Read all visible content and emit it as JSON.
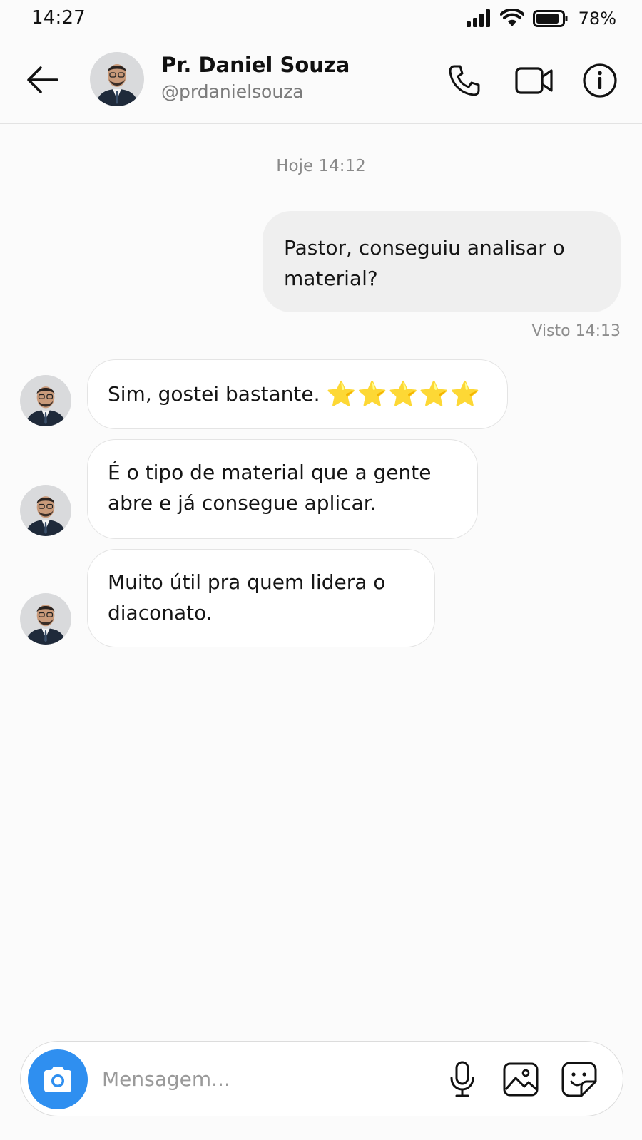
{
  "status_bar": {
    "time": "14:27",
    "battery": "78%"
  },
  "header": {
    "name": "Pr. Daniel Souza",
    "handle": "@prdanielsouza",
    "icons": [
      "back-arrow-icon",
      "phone-icon",
      "video-camera-icon",
      "info-icon"
    ]
  },
  "chat": {
    "timestamp": "Hoje 14:12",
    "outgoing": {
      "line1": "Pastor, conseguiu analisar o",
      "line2": "material?"
    },
    "seen": "Visto 14:13",
    "incoming": [
      {
        "line1": "Sim, gostei bastante.",
        "stars": "⭐⭐⭐⭐⭐"
      },
      {
        "line1": "É o tipo de material que a gente",
        "line2": "abre e já consegue aplicar."
      },
      {
        "line1": "Muito útil pra quem lidera o",
        "line2": "diaconato."
      }
    ]
  },
  "composer": {
    "placeholder": "Mensagem...",
    "icons": [
      "camera-icon",
      "microphone-icon",
      "image-icon",
      "sticker-icon"
    ]
  },
  "colors": {
    "accent": "#2f8ff0",
    "outgoing_bubble": "#efefef",
    "incoming_border": "#e4e4e4"
  }
}
